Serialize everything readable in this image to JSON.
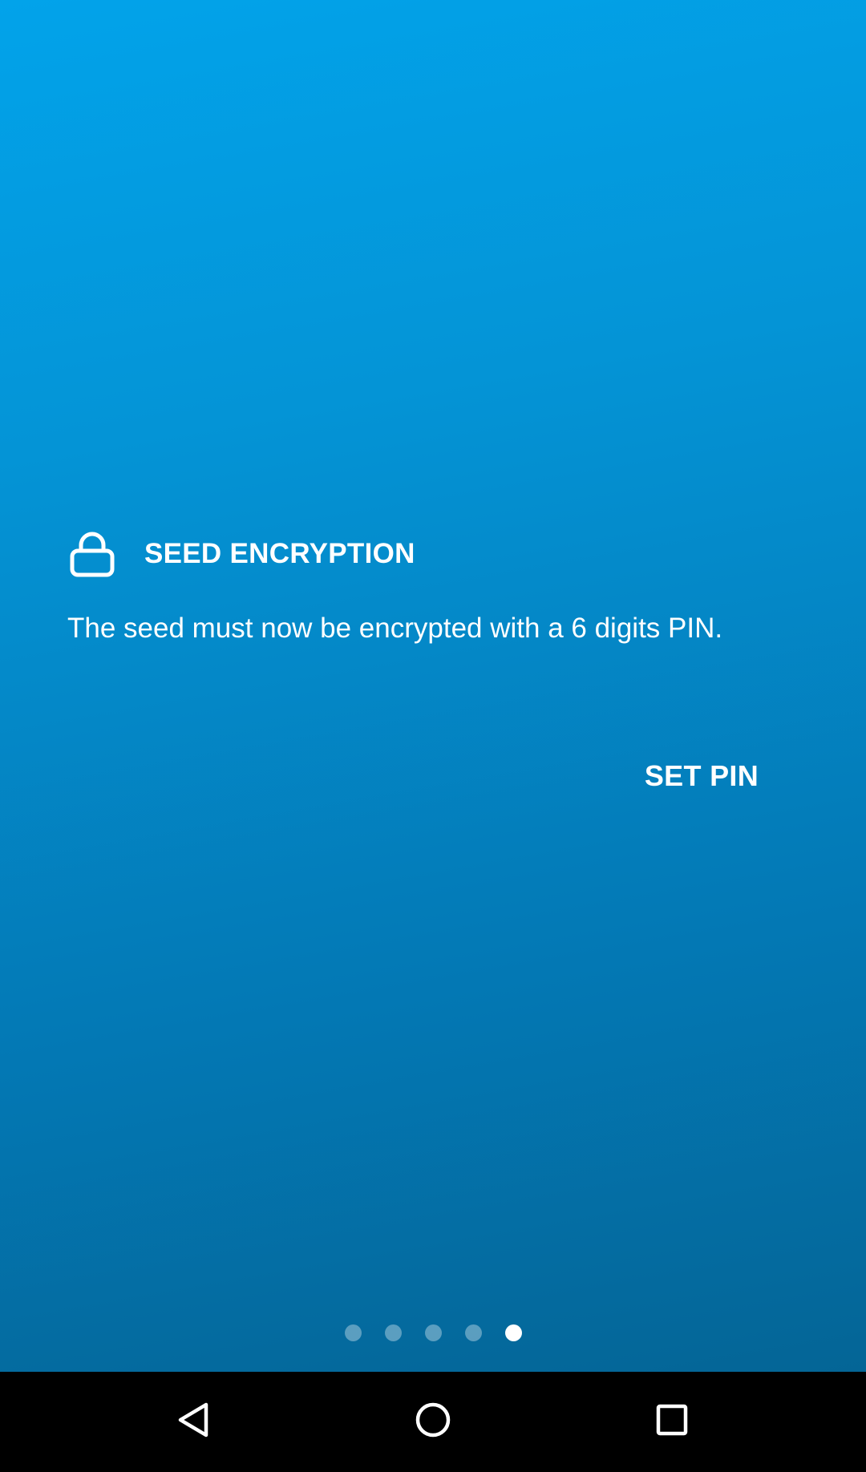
{
  "onboarding": {
    "icon": "lock-icon",
    "title": "SEED ENCRYPTION",
    "description": "The seed must now be encrypted with a 6 digits PIN.",
    "action_label": "SET PIN",
    "page_indicator": {
      "total": 5,
      "current": 5
    }
  },
  "colors": {
    "gradient_top": "#02a3ea",
    "gradient_bottom": "#046596",
    "text": "#ffffff",
    "nav_bar": "#000000"
  },
  "nav_bar": {
    "buttons": [
      "back-icon",
      "home-icon",
      "recents-icon"
    ]
  }
}
